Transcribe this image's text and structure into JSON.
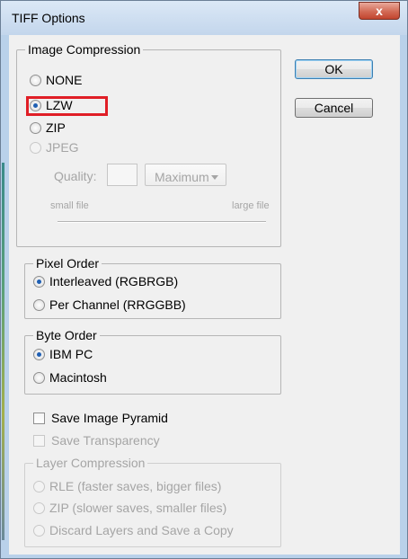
{
  "window": {
    "title": "TIFF Options",
    "close_label": "x"
  },
  "buttons": {
    "ok": "OK",
    "cancel": "Cancel"
  },
  "image_compression": {
    "legend": "Image Compression",
    "options": [
      "NONE",
      "LZW",
      "ZIP",
      "JPEG"
    ],
    "selected": "LZW",
    "quality_label": "Quality:",
    "quality_value": "",
    "quality_select": "Maximum",
    "small_file": "small file",
    "large_file": "large file"
  },
  "pixel_order": {
    "legend": "Pixel Order",
    "options": [
      "Interleaved (RGBRGB)",
      "Per Channel (RRGGBB)"
    ],
    "selected": "Interleaved (RGBRGB)"
  },
  "byte_order": {
    "legend": "Byte Order",
    "options": [
      "IBM PC",
      "Macintosh"
    ],
    "selected": "IBM PC"
  },
  "checkboxes": {
    "save_image_pyramid": "Save Image Pyramid",
    "save_transparency": "Save Transparency"
  },
  "layer_compression": {
    "legend": "Layer Compression",
    "options": [
      "RLE (faster saves, bigger files)",
      "ZIP (slower saves, smaller files)",
      "Discard Layers and Save a Copy"
    ]
  },
  "colors": {
    "highlight": "#e01e26",
    "radio_dot": "#1f5fb3",
    "disabled_text": "#a5a5a5"
  }
}
